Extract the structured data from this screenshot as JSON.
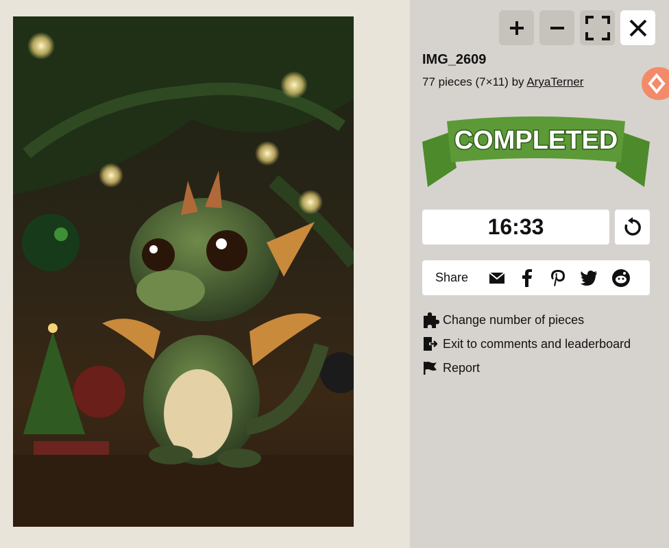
{
  "toolbar": {
    "zoom_in_label": "+",
    "zoom_out_label": "−"
  },
  "puzzle": {
    "title": "IMG_2609",
    "pieces_text": "77 pieces (7×11) by",
    "author": "AryaTerner"
  },
  "completed_banner": {
    "text": "COMPLETED",
    "ribbon_color": "#5b9a36",
    "text_outline_color": "#2f5a18"
  },
  "timer": {
    "value": "16:33"
  },
  "share": {
    "label": "Share",
    "icons": [
      "email-icon",
      "facebook-icon",
      "pinterest-icon",
      "twitter-icon",
      "reddit-icon"
    ]
  },
  "menu": {
    "change_pieces": "Change number of pieces",
    "exit": "Exit to comments and leaderboard",
    "report": "Report"
  },
  "colors": {
    "panel_bg": "#d6d3ce",
    "stage_bg": "#e9e4da",
    "accent_badge": "#f38b6a"
  }
}
